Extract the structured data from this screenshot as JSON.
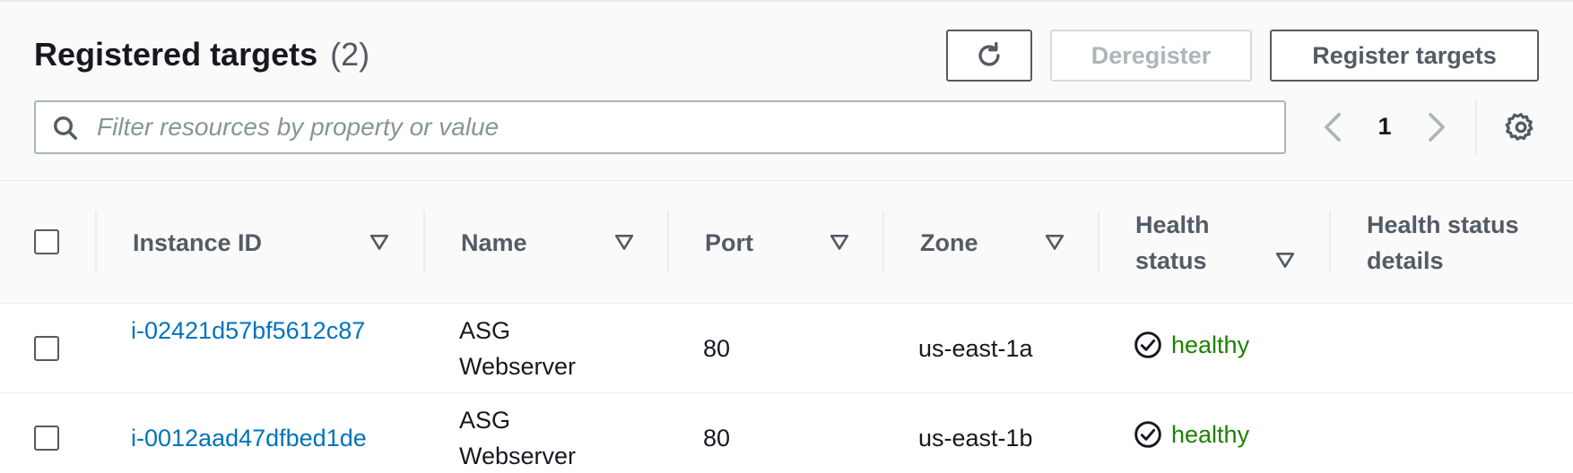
{
  "header": {
    "title": "Registered targets",
    "count": "(2)",
    "refresh_icon": "refresh-icon",
    "deregister_label": "Deregister",
    "register_label": "Register targets"
  },
  "filter": {
    "icon": "search-icon",
    "placeholder": "Filter resources by property or value",
    "value": ""
  },
  "pagination": {
    "current_page": "1",
    "prev_icon": "chevron-left-icon",
    "next_icon": "chevron-right-icon",
    "settings_icon": "gear-icon"
  },
  "table": {
    "columns": [
      {
        "label": "Instance ID",
        "sortable": true
      },
      {
        "label": "Name",
        "sortable": true
      },
      {
        "label": "Port",
        "sortable": true
      },
      {
        "label": "Zone",
        "sortable": true
      },
      {
        "label": "Health status",
        "sortable": true
      },
      {
        "label": "Health status details",
        "sortable": false
      }
    ],
    "rows": [
      {
        "instance_id": "i-02421d57bf5612c87",
        "name": "ASG Webserver",
        "port": "80",
        "zone": "us-east-1a",
        "health": "healthy",
        "health_details": ""
      },
      {
        "instance_id": "i-0012aad47dfbed1de",
        "name": "ASG Webserver",
        "port": "80",
        "zone": "us-east-1b",
        "health": "healthy",
        "health_details": ""
      }
    ]
  },
  "colors": {
    "link": "#0073bb",
    "healthy": "#1d8102",
    "disabled": "#aab7b8"
  }
}
